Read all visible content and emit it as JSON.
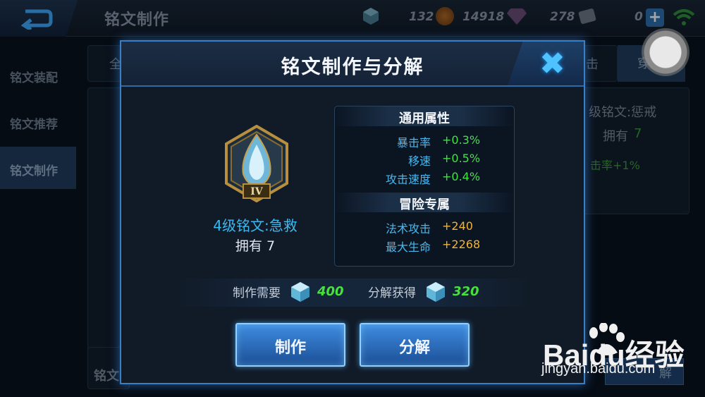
{
  "topbar": {
    "title": "铭文制作",
    "currencies": [
      {
        "icon": "crystal-icon",
        "value": "132"
      },
      {
        "icon": "gold-coin-icon",
        "value": "14918"
      },
      {
        "icon": "diamond-icon",
        "value": "278"
      },
      {
        "icon": "voucher-icon",
        "value": "0"
      }
    ]
  },
  "background": {
    "sidebar": [
      "铭文装配",
      "铭文推荐",
      "铭文制作"
    ],
    "tab_partial_left": "全",
    "tab_partial_right": "击",
    "tab_penetration": "穿透",
    "right_panel": {
      "name": "级铭文:惩戒",
      "own": "拥有",
      "own_count": "7",
      "stat": "击率+1%"
    },
    "bottom_left": "铭文",
    "bottom_right_btn": "解"
  },
  "dialog": {
    "title": "铭文制作与分解",
    "rune": {
      "name": "4级铭文:急救",
      "own_label": "拥有 7",
      "level_roman": "IV"
    },
    "general_header": "通用属性",
    "general_stats": [
      {
        "key": "暴击率",
        "value": "+0.3%"
      },
      {
        "key": "移速",
        "value": "+0.5%"
      },
      {
        "key": "攻击速度",
        "value": "+0.4%"
      }
    ],
    "adventure_header": "冒险专属",
    "adventure_stats": [
      {
        "key": "法术攻击",
        "value": "+240"
      },
      {
        "key": "最大生命",
        "value": "+2268"
      }
    ],
    "craft_cost_label": "制作需要",
    "craft_cost_value": "400",
    "decompose_label": "分解获得",
    "decompose_value": "320",
    "craft_button": "制作",
    "decompose_button": "分解"
  },
  "watermark": {
    "brand": "Baidu经验",
    "url": "jingyan.baidu.com"
  }
}
